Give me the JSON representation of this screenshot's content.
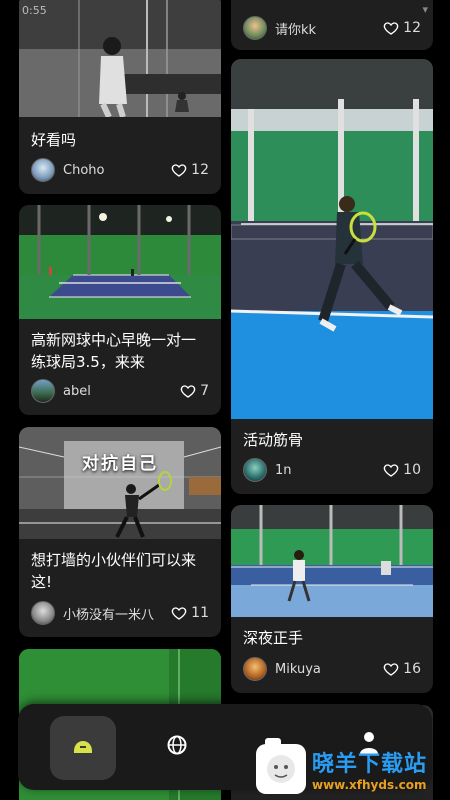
{
  "status_bar": {
    "time": "0:55",
    "wifi_icon": "wifi-icon"
  },
  "colors": {
    "background": "#000000",
    "card": "#1f1f1f",
    "accent_home": "#d8e24a",
    "watermark_blue": "#2a9cf2",
    "watermark_orange": "#e8a020"
  },
  "feed": {
    "left": [
      {
        "title": "好看吗",
        "author": "Choho",
        "likes": "12"
      },
      {
        "title": "高新网球中心早晚一对一练球局3.5，来来",
        "author": "abel",
        "likes": "7"
      },
      {
        "title": "想打墙的小伙伴们可以来这!",
        "author": "小杨没有一米八",
        "likes": "11",
        "overlay": "对抗自己"
      },
      {
        "title": "",
        "author": "",
        "likes": ""
      }
    ],
    "right": [
      {
        "title": "",
        "author": "请你kk",
        "likes": "12"
      },
      {
        "title": "活动筋骨",
        "author": "1n",
        "likes": "10"
      },
      {
        "title": "深夜正手",
        "author": "Mikuya",
        "likes": "16"
      },
      {
        "title": "",
        "author": "",
        "likes": ""
      }
    ]
  },
  "bottom_nav": {
    "items": [
      {
        "name": "home",
        "icon": "home-icon",
        "active": true
      },
      {
        "name": "explore",
        "icon": "globe-icon",
        "active": false
      },
      {
        "name": "third",
        "icon": "tab-icon",
        "active": false
      },
      {
        "name": "profile",
        "icon": "person-icon",
        "active": false
      }
    ]
  },
  "watermark": {
    "name": "晓羊下载站",
    "url": "www.xfhyds.com"
  }
}
